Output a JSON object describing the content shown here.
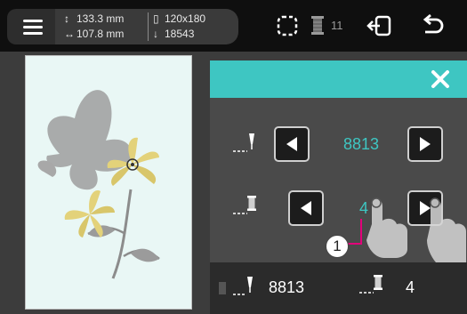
{
  "topbar": {
    "height_value": "133.3 mm",
    "width_value": "107.8 mm",
    "hoop_size": "120x180",
    "stitch_count": "18543",
    "thread_change_count": "11"
  },
  "panel": {
    "needle_position_value": "8813",
    "thread_position_value": "4"
  },
  "bottom": {
    "stitch_value": "8813",
    "thread_value": "4"
  },
  "callout": {
    "number": "1"
  },
  "colors": {
    "accent": "#3ec6c2",
    "preview_bg": "#e9f7f5",
    "thread_yellow": "#e3d27a",
    "callout_line": "#e2007a"
  },
  "icons": [
    "menu-icon",
    "height-icon",
    "width-icon",
    "hoop-icon",
    "needle-icon",
    "layout-frame-icon",
    "thread-spool-icon",
    "exit-icon",
    "back-icon",
    "close-icon",
    "arrow-left-icon",
    "arrow-right-icon"
  ]
}
